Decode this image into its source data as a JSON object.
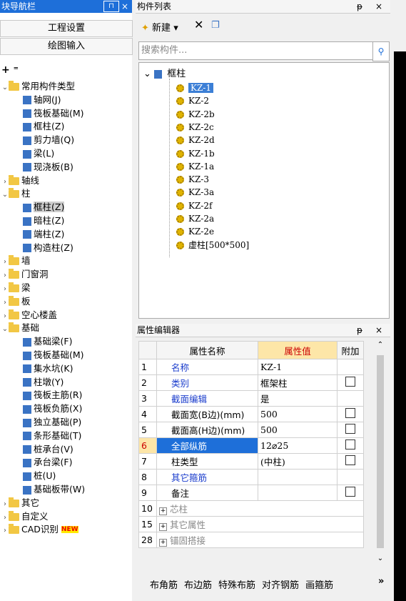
{
  "nav": {
    "title": "块导航栏",
    "btn_project": "工程设置",
    "btn_drawing": "绘图输入",
    "tree": [
      {
        "label": "常用构件类型",
        "level": 0,
        "type": "folder",
        "expanded": true
      },
      {
        "label": "轴网(J)",
        "level": 1,
        "type": "comp"
      },
      {
        "label": "筏板基础(M)",
        "level": 1,
        "type": "comp"
      },
      {
        "label": "框柱(Z)",
        "level": 1,
        "type": "comp"
      },
      {
        "label": "剪力墙(Q)",
        "level": 1,
        "type": "comp"
      },
      {
        "label": "梁(L)",
        "level": 1,
        "type": "comp"
      },
      {
        "label": "现浇板(B)",
        "level": 1,
        "type": "comp"
      },
      {
        "label": "轴线",
        "level": 0,
        "type": "folder"
      },
      {
        "label": "柱",
        "level": 0,
        "type": "folder",
        "expanded": true
      },
      {
        "label": "框柱(Z)",
        "level": 1,
        "type": "comp",
        "selected": true
      },
      {
        "label": "暗柱(Z)",
        "level": 1,
        "type": "comp"
      },
      {
        "label": "端柱(Z)",
        "level": 1,
        "type": "comp"
      },
      {
        "label": "构造柱(Z)",
        "level": 1,
        "type": "comp"
      },
      {
        "label": "墙",
        "level": 0,
        "type": "folder"
      },
      {
        "label": "门窗洞",
        "level": 0,
        "type": "folder"
      },
      {
        "label": "梁",
        "level": 0,
        "type": "folder"
      },
      {
        "label": "板",
        "level": 0,
        "type": "folder"
      },
      {
        "label": "空心楼盖",
        "level": 0,
        "type": "folder"
      },
      {
        "label": "基础",
        "level": 0,
        "type": "folder",
        "expanded": true
      },
      {
        "label": "基础梁(F)",
        "level": 1,
        "type": "comp"
      },
      {
        "label": "筏板基础(M)",
        "level": 1,
        "type": "comp"
      },
      {
        "label": "集水坑(K)",
        "level": 1,
        "type": "comp"
      },
      {
        "label": "柱墩(Y)",
        "level": 1,
        "type": "comp"
      },
      {
        "label": "筏板主筋(R)",
        "level": 1,
        "type": "comp"
      },
      {
        "label": "筏板负筋(X)",
        "level": 1,
        "type": "comp"
      },
      {
        "label": "独立基础(P)",
        "level": 1,
        "type": "comp"
      },
      {
        "label": "条形基础(T)",
        "level": 1,
        "type": "comp"
      },
      {
        "label": "桩承台(V)",
        "level": 1,
        "type": "comp"
      },
      {
        "label": "承台梁(F)",
        "level": 1,
        "type": "comp"
      },
      {
        "label": "桩(U)",
        "level": 1,
        "type": "comp"
      },
      {
        "label": "基础板带(W)",
        "level": 1,
        "type": "comp"
      },
      {
        "label": "其它",
        "level": 0,
        "type": "folder"
      },
      {
        "label": "自定义",
        "level": 0,
        "type": "folder"
      },
      {
        "label": "CAD识别",
        "level": 0,
        "type": "folder",
        "badge": "NEW"
      }
    ]
  },
  "list": {
    "title": "构件列表",
    "new_label": "新建",
    "search_placeholder": "搜索构件...",
    "root": "框柱",
    "items": [
      "KZ-1",
      "KZ-2",
      "KZ-2b",
      "KZ-2c",
      "KZ-2d",
      "KZ-1b",
      "KZ-1a",
      "KZ-3",
      "KZ-3a",
      "KZ-2f",
      "KZ-2a",
      "KZ-2e",
      "虚柱[500*500]"
    ]
  },
  "prop": {
    "title": "属性编辑器",
    "col_name": "属性名称",
    "col_value": "属性值",
    "col_extra": "附加",
    "rows": [
      {
        "num": "1",
        "name": "名称",
        "value": "KZ-1",
        "blue": true,
        "cb": false
      },
      {
        "num": "2",
        "name": "类别",
        "value": "框架柱",
        "blue": true,
        "cb": true
      },
      {
        "num": "3",
        "name": "截面编辑",
        "value": "是",
        "blue": true,
        "cb": false
      },
      {
        "num": "4",
        "name": "截面宽(B边)(mm)",
        "value": "500",
        "blue": false,
        "cb": true
      },
      {
        "num": "5",
        "name": "截面高(H边)(mm)",
        "value": "500",
        "blue": false,
        "cb": true
      },
      {
        "num": "6",
        "name": "全部纵筋",
        "value": "12⌀25",
        "blue": false,
        "cb": true,
        "selected": true
      },
      {
        "num": "7",
        "name": "柱类型",
        "value": "(中柱)",
        "blue": false,
        "cb": true
      },
      {
        "num": "8",
        "name": "其它箍筋",
        "value": "",
        "blue": true,
        "cb": false
      },
      {
        "num": "9",
        "name": "备注",
        "value": "",
        "blue": false,
        "cb": true
      },
      {
        "num": "10",
        "name": "芯柱",
        "value": "",
        "gray": true,
        "plus": true
      },
      {
        "num": "15",
        "name": "其它属性",
        "value": "",
        "gray": true,
        "plus": true
      },
      {
        "num": "28",
        "name": "锚固搭接",
        "value": "",
        "gray": true,
        "plus": true
      }
    ],
    "bottom_buttons": [
      "布角筋",
      "布边筋",
      "特殊布筋",
      "对齐钢筋",
      "画箍筋"
    ]
  },
  "colors": {
    "accent": "#1e6fd9",
    "selection": "#3c7fd6",
    "value_header": "#fde6a8"
  }
}
